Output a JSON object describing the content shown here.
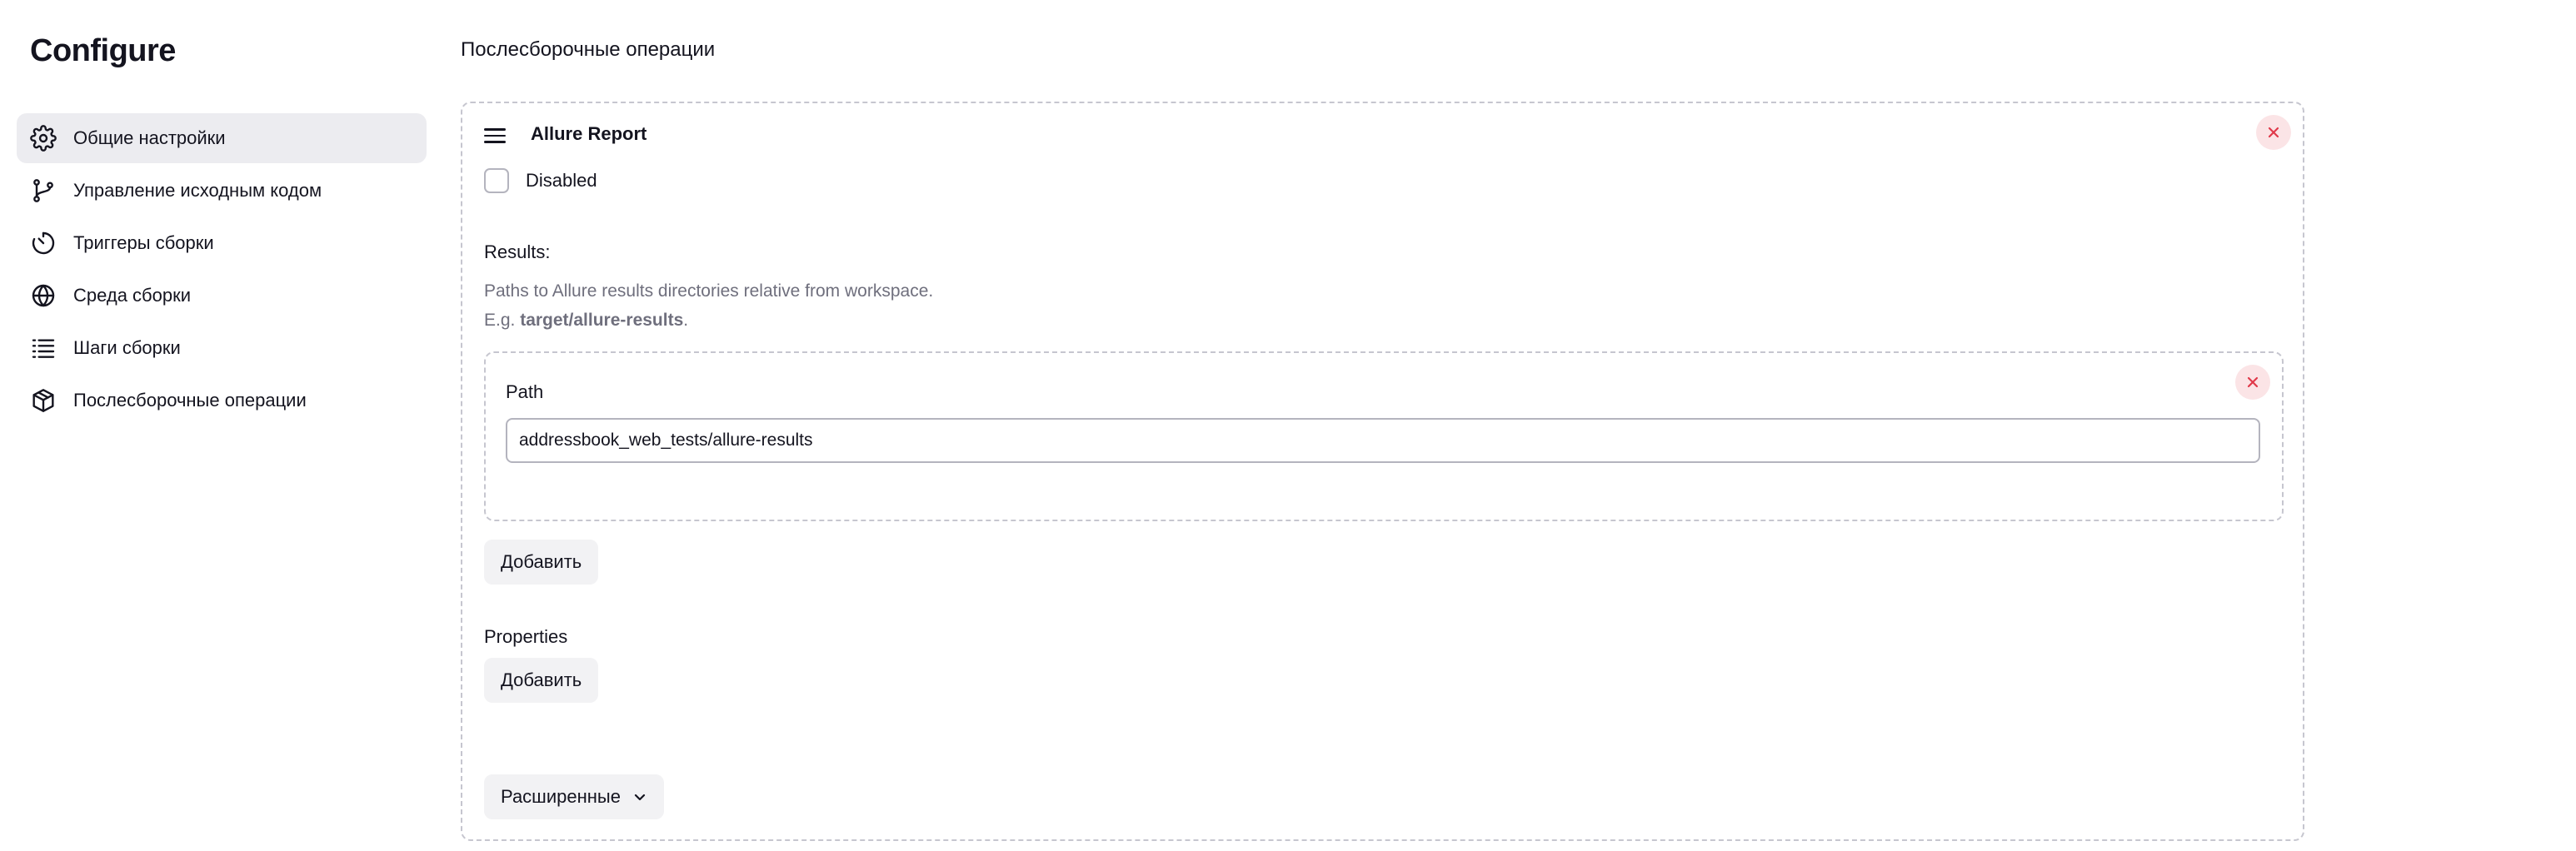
{
  "app": {
    "title": "Configure"
  },
  "sidebar": {
    "items": [
      {
        "label": "Общие настройки",
        "icon": "gear-icon",
        "active": true
      },
      {
        "label": "Управление исходным кодом",
        "icon": "source-branch-icon",
        "active": false
      },
      {
        "label": "Триггеры сборки",
        "icon": "timer-icon",
        "active": false
      },
      {
        "label": "Среда сборки",
        "icon": "globe-icon",
        "active": false
      },
      {
        "label": "Шаги сборки",
        "icon": "list-icon",
        "active": false
      },
      {
        "label": "Послесборочные операции",
        "icon": "package-icon",
        "active": false
      }
    ]
  },
  "main": {
    "section_title": "Послесборочные операции",
    "operation": {
      "title": "Allure Report",
      "disabled_label": "Disabled",
      "disabled_checked": false,
      "results_label": "Results:",
      "help_line1": "Paths to Allure results directories relative from workspace.",
      "help_prefix": "E.g. ",
      "help_example": "target/allure-results",
      "help_suffix": ".",
      "path": {
        "label": "Path",
        "value": "addressbook_web_tests/allure-results"
      },
      "add_results_label": "Добавить",
      "properties_label": "Properties",
      "add_properties_label": "Добавить",
      "advanced_label": "Расширенные"
    }
  },
  "colors": {
    "accent_active_bg": "#ececf0",
    "danger": "#e0394a",
    "danger_bg": "#fbe4e6",
    "muted_text": "#6f6f7d",
    "border_dashed": "#c6c6cf"
  }
}
